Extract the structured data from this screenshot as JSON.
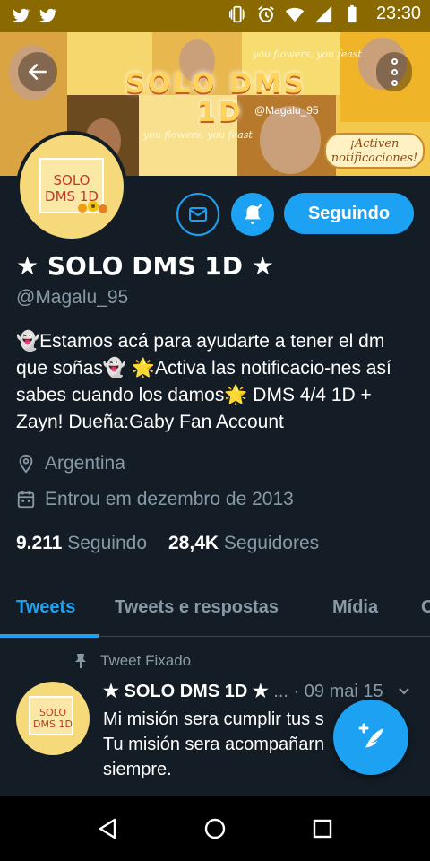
{
  "status_bar": {
    "time": "23:30",
    "icons": [
      "twitter-icon",
      "twitter-icon",
      "vibrate-icon",
      "alarm-icon",
      "wifi-icon",
      "signal-icon",
      "battery-icon"
    ]
  },
  "banner": {
    "title_line1": "SOLO DMS",
    "title_line2": "1D",
    "handle": "@Magalu_95",
    "script_1": "you flowers, you feast",
    "script_2": "you flowers, you feast",
    "notif_line1": "¡Activen",
    "notif_line2": "notificaciones!"
  },
  "avatar": {
    "line1": "SOLO",
    "line2": "DMS 1D"
  },
  "actions": {
    "follow_label": "Seguindo"
  },
  "profile": {
    "name": "★ SOLO DMS 1D ★",
    "handle": "@Magalu_95",
    "bio": "👻Estamos acá para ayudarte a tener el dm que soñas👻 🌟Activa las notificacio-nes así sabes cuando los damos🌟 DMS 4/4 1D + Zayn! Dueña:Gaby Fan Account",
    "location": "Argentina",
    "joined": "Entrou em dezembro de 2013",
    "following_count": "9.211",
    "following_label": "Seguindo",
    "followers_count": "28,4K",
    "followers_label": "Seguidores"
  },
  "tabs": [
    {
      "label": "Tweets"
    },
    {
      "label": "Tweets e respostas"
    },
    {
      "label": "Mídia"
    },
    {
      "label": "C"
    }
  ],
  "pinned_tweet": {
    "pinned_label": "Tweet Fixado",
    "author": "★ SOLO DMS 1D ★",
    "meta": " ... · 09 mai 15",
    "line1": "Mi misión sera cumplir tus s",
    "line2": "Tu misión sera acompañarn",
    "line3": "siempre.",
    "avatar_line1": "SOLO",
    "avatar_line2": "DMS 1D"
  },
  "colors": {
    "accent": "#1da1f2",
    "background": "#141d26",
    "muted": "#8899a6",
    "status_bar": "#8a6a00"
  }
}
